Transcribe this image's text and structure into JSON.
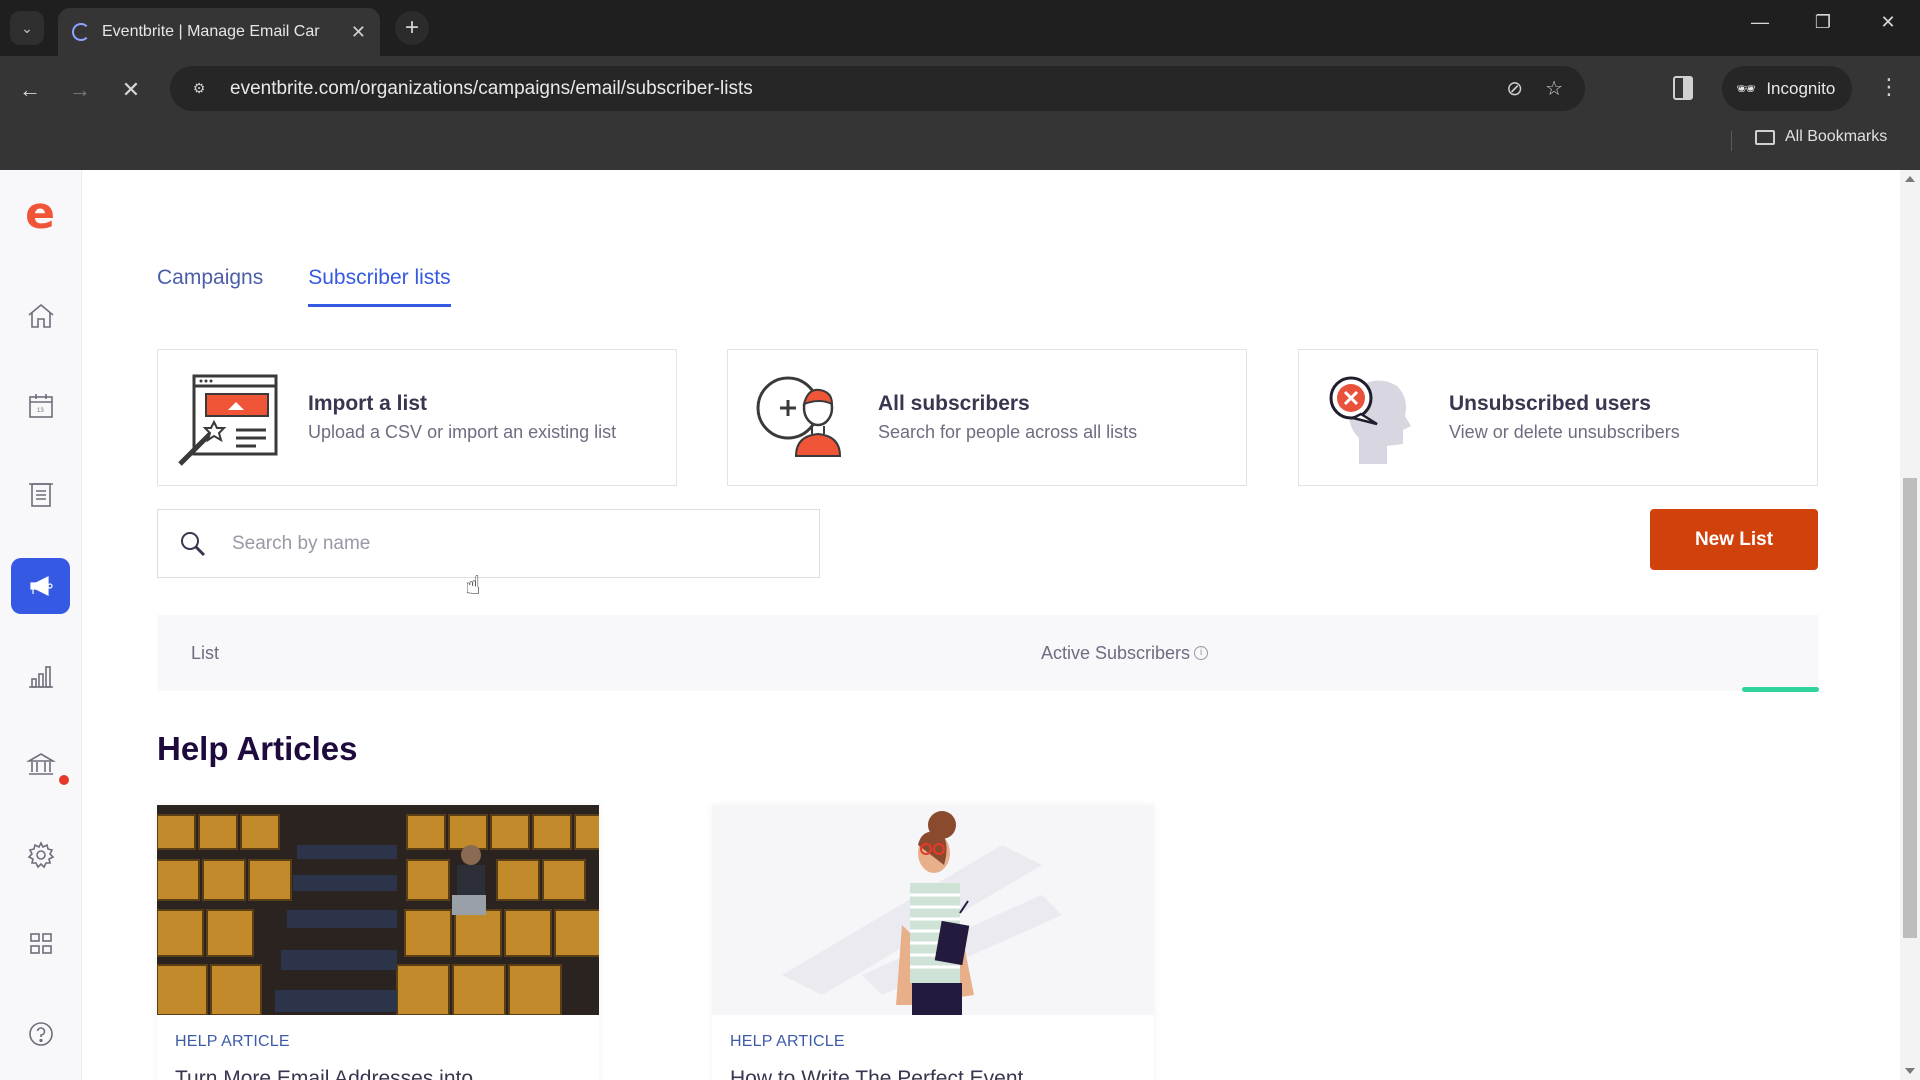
{
  "browser": {
    "tab_title": "Eventbrite | Manage Email Car",
    "url": "eventbrite.com/organizations/campaigns/email/subscriber-lists",
    "profile_label": "Incognito",
    "bookmarks_label": "All Bookmarks"
  },
  "sidebar": {
    "logo": "e",
    "items": [
      {
        "name": "home",
        "icon": "home-icon"
      },
      {
        "name": "events",
        "icon": "calendar-icon"
      },
      {
        "name": "orders",
        "icon": "receipt-icon"
      },
      {
        "name": "marketing",
        "icon": "megaphone-icon",
        "active": true
      },
      {
        "name": "reports",
        "icon": "bar-chart-icon"
      },
      {
        "name": "finance",
        "icon": "bank-icon",
        "badge": true
      },
      {
        "name": "settings",
        "icon": "gear-icon"
      },
      {
        "name": "apps",
        "icon": "grid-icon"
      },
      {
        "name": "help",
        "icon": "help-icon"
      }
    ]
  },
  "tabs": [
    {
      "label": "Campaigns",
      "active": false
    },
    {
      "label": "Subscriber lists",
      "active": true
    }
  ],
  "cards": [
    {
      "title": "Import a list",
      "description": "Upload a CSV or import an existing list"
    },
    {
      "title": "All subscribers",
      "description": "Search for people across all lists"
    },
    {
      "title": "Unsubscribed users",
      "description": "View or delete unsubscribers"
    }
  ],
  "search": {
    "placeholder": "Search by name",
    "value": ""
  },
  "new_list_label": "New List",
  "table": {
    "columns": [
      "List",
      "Active Subscribers"
    ],
    "info_icon": "i"
  },
  "help": {
    "title": "Help Articles",
    "articles": [
      {
        "kicker": "HELP ARTICLE",
        "title": "Turn More Email Addresses into"
      },
      {
        "kicker": "HELP ARTICLE",
        "title": "How to Write The Perfect Event"
      }
    ]
  },
  "colors": {
    "brand": "#f05537",
    "accent": "#3659e3",
    "cta": "#d1410c",
    "loader": "#2fd59a"
  }
}
